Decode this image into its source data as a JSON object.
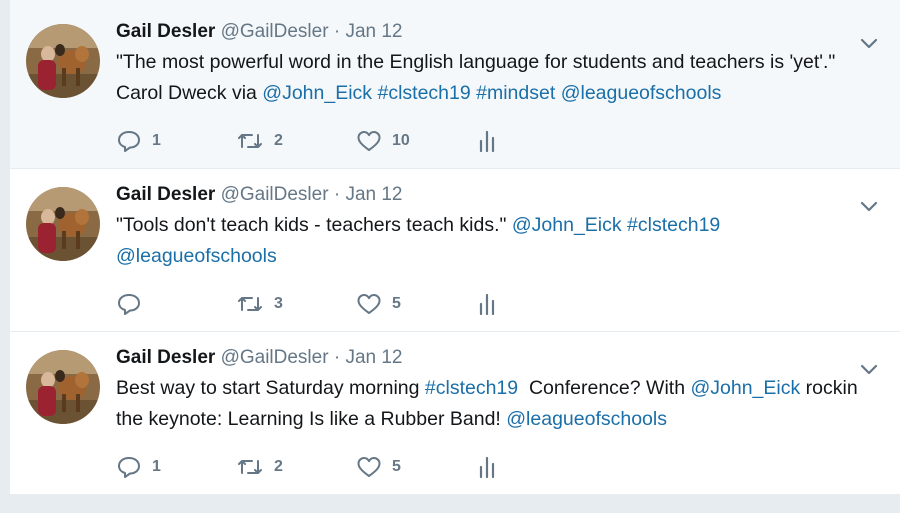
{
  "tweets": [
    {
      "name": "Gail Desler",
      "handle": "@GailDesler",
      "separator": "·",
      "date": "Jan 12",
      "segments": [
        {
          "t": "\"The most powerful word in the English language for students and teachers is 'yet'.\" Carol Dweck via ",
          "link": false
        },
        {
          "t": "@John_Eick",
          "link": true
        },
        {
          "t": " ",
          "link": false
        },
        {
          "t": "#clstech19",
          "link": true
        },
        {
          "t": " ",
          "link": false
        },
        {
          "t": "#mindset",
          "link": true
        },
        {
          "t": " ",
          "link": false
        },
        {
          "t": "@leagueofschools",
          "link": true
        }
      ],
      "reply_count": "1",
      "retweet_count": "2",
      "like_count": "10"
    },
    {
      "name": "Gail Desler",
      "handle": "@GailDesler",
      "separator": "·",
      "date": "Jan 12",
      "segments": [
        {
          "t": "\"Tools don't teach kids - teachers teach kids.\" ",
          "link": false
        },
        {
          "t": "@John_Eick",
          "link": true
        },
        {
          "t": " ",
          "link": false
        },
        {
          "t": "#clstech19",
          "link": true
        },
        {
          "t": " ",
          "link": false
        },
        {
          "t": "@leagueofschools",
          "link": true
        }
      ],
      "reply_count": "",
      "retweet_count": "3",
      "like_count": "5"
    },
    {
      "name": "Gail Desler",
      "handle": "@GailDesler",
      "separator": "·",
      "date": "Jan 12",
      "segments": [
        {
          "t": "Best way to start Saturday morning ",
          "link": false
        },
        {
          "t": "#clstech19",
          "link": true
        },
        {
          "t": "  Conference? With ",
          "link": false
        },
        {
          "t": "@John_Eick",
          "link": true
        },
        {
          "t": " rockin the keynote: Learning Is like a Rubber Band! ",
          "link": false
        },
        {
          "t": "@leagueofschools",
          "link": true
        }
      ],
      "reply_count": "1",
      "retweet_count": "2",
      "like_count": "5"
    }
  ],
  "icons": {
    "reply": "reply-icon",
    "retweet": "retweet-icon",
    "like": "heart-icon",
    "analytics": "analytics-icon",
    "caret": "chevron-down-icon"
  },
  "colors": {
    "link": "#1b6fa8",
    "muted": "#657786",
    "highlight_bg": "#f5f8fa",
    "page_bg": "#e6ecf0"
  }
}
